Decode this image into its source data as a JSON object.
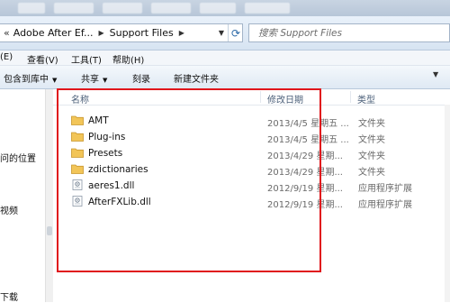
{
  "address_bar": {
    "overflow_glyph": "«",
    "crumbs": [
      "Adobe After Ef...",
      "Support Files"
    ],
    "search_placeholder": "搜索 Support Files"
  },
  "menu": {
    "items": [
      "(E)",
      "查看(V)",
      "工具(T)",
      "帮助(H)"
    ]
  },
  "toolbar": {
    "include_in_library": "包含到库中",
    "share": "共享",
    "burn": "刻录",
    "new_folder": "新建文件夹"
  },
  "nav_pane": {
    "items": [
      "问的位置",
      "视频",
      "下载"
    ]
  },
  "columns": {
    "name": "名称",
    "date_modified": "修改日期",
    "type": "类型"
  },
  "files": [
    {
      "name": "AMT",
      "date": "2013/4/5 星期五 ...",
      "type": "文件夹",
      "icon": "folder-icon"
    },
    {
      "name": "Plug-ins",
      "date": "2013/4/5 星期五 ...",
      "type": "文件夹",
      "icon": "folder-icon"
    },
    {
      "name": "Presets",
      "date": "2013/4/29 星期...",
      "type": "文件夹",
      "icon": "folder-icon"
    },
    {
      "name": "zdictionaries",
      "date": "2013/4/29 星期...",
      "type": "文件夹",
      "icon": "folder-icon"
    },
    {
      "name": "aeres1.dll",
      "date": "2012/9/19 星期...",
      "type": "应用程序扩展",
      "icon": "dll-file-icon"
    },
    {
      "name": "AfterFXLib.dll",
      "date": "2012/9/19 星期...",
      "type": "应用程序扩展",
      "icon": "dll-file-icon"
    }
  ],
  "colors": {
    "highlight_box": "#e0161c",
    "folder": "#f2c558",
    "column_header_text": "#4c607a"
  }
}
